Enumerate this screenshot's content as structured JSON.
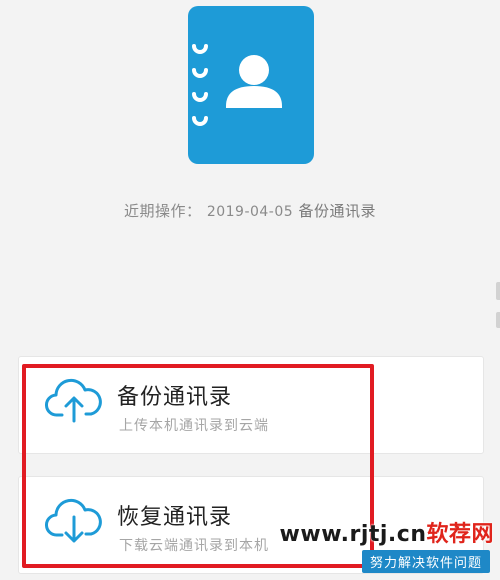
{
  "last_operation": {
    "label": "近期操作：",
    "date": "2019-04-05",
    "action": "备份通讯录"
  },
  "cards": {
    "backup": {
      "title": "备份通讯录",
      "subtitle": "上传本机通讯录到云端",
      "icon": "cloud-upload-icon"
    },
    "restore": {
      "title": "恢复通讯录",
      "subtitle": "下载云端通讯录到本机",
      "icon": "cloud-download-icon"
    }
  },
  "watermark": {
    "site": "www.rjtj.cn",
    "brand": "软荐网",
    "slogan": "努力解决软件问题"
  },
  "colors": {
    "brand_blue": "#1e9bd7",
    "highlight_red": "#e11b22",
    "card_bg": "#ffffff",
    "page_bg": "#f3f3f3"
  }
}
